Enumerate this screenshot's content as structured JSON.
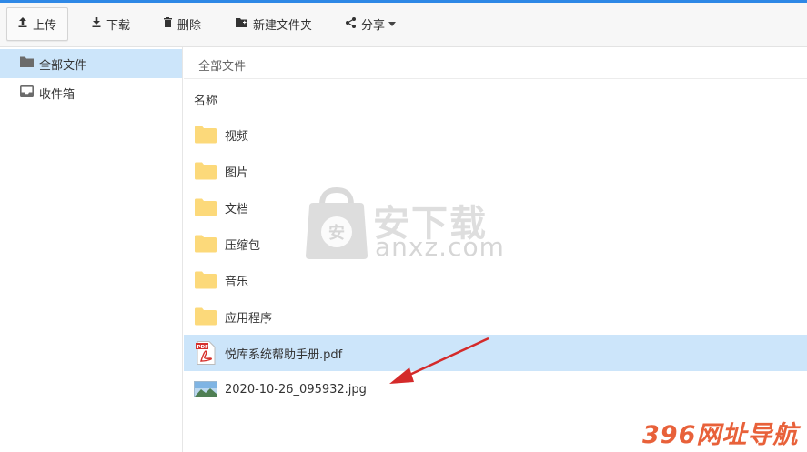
{
  "toolbar": {
    "upload_label": "上传",
    "download_label": "下载",
    "delete_label": "删除",
    "new_folder_label": "新建文件夹",
    "share_label": "分享"
  },
  "sidebar": {
    "items": [
      {
        "label": "全部文件",
        "icon": "folder-icon",
        "selected": true
      },
      {
        "label": "收件箱",
        "icon": "inbox-icon",
        "selected": false
      }
    ]
  },
  "main": {
    "breadcrumb": "全部文件",
    "column_header": "名称",
    "files": [
      {
        "name": "视频",
        "type": "folder"
      },
      {
        "name": "图片",
        "type": "folder"
      },
      {
        "name": "文档",
        "type": "folder"
      },
      {
        "name": "压缩包",
        "type": "folder"
      },
      {
        "name": "音乐",
        "type": "folder"
      },
      {
        "name": "应用程序",
        "type": "folder"
      },
      {
        "name": "悦库系统帮助手册.pdf",
        "type": "pdf",
        "selected": true
      },
      {
        "name": "2020-10-26_095932.jpg",
        "type": "image"
      }
    ]
  },
  "watermarks": {
    "logo_badge": "安",
    "logo_name": "安下载",
    "logo_domain": "anxz.com",
    "corner_text": "396网址导航"
  },
  "colors": {
    "accent": "#2e88e6",
    "selection": "#cce5fa",
    "folder": "#fcd97a",
    "pdf_red": "#d6302c",
    "annotation_arrow": "#d42a2a"
  }
}
